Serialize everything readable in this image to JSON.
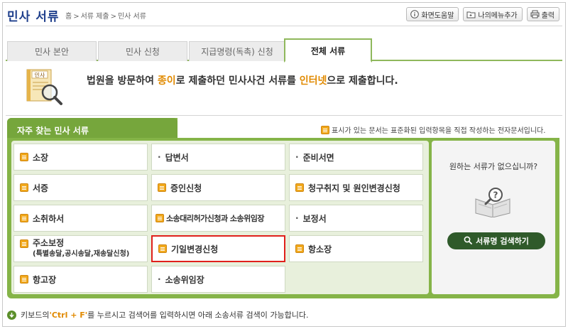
{
  "header": {
    "title": "민사 서류",
    "breadcrumb": [
      "홈",
      ">",
      "서류 제출",
      ">",
      "민사 서류"
    ],
    "buttons": {
      "help": "화면도움말",
      "add_menu": "나의메뉴추가",
      "print": "출력"
    }
  },
  "tabs": [
    {
      "label": "민사 본안",
      "active": false
    },
    {
      "label": "민사 신청",
      "active": false
    },
    {
      "label": "지급명령(독촉) 신청",
      "active": false
    },
    {
      "label": "전체 서류",
      "active": true
    }
  ],
  "intro": {
    "icon_label": "민사",
    "text_before": "법원을 방문하여 ",
    "highlight1": "종이",
    "text_mid": "로 제출하던 민사사건 서류를 ",
    "highlight2": "인터넷",
    "text_after": "으로 제출합니다."
  },
  "panel": {
    "title": "자주 찾는 민사 서류",
    "legend_note": "표시가 있는 문서는 표준화된 입력항목을 직접 작성하는 전자문서입니다.",
    "cells": [
      {
        "label": "소장",
        "type": "doc"
      },
      {
        "label": "답변서",
        "type": "dot"
      },
      {
        "label": "준비서면",
        "type": "dot"
      },
      {
        "label": "서증",
        "type": "doc"
      },
      {
        "label": "증인신청",
        "type": "doc"
      },
      {
        "label": "청구취지 및 원인변경신청",
        "type": "doc"
      },
      {
        "label": "소취하서",
        "type": "doc"
      },
      {
        "label": "소송대리허가신청과 소송위임장",
        "type": "doc"
      },
      {
        "label": "보정서",
        "type": "dot"
      },
      {
        "label": "주소보정",
        "sub": "(특별송달,공시송달,재송달신청)",
        "type": "doc"
      },
      {
        "label": "기일변경신청",
        "type": "doc",
        "highlight": true
      },
      {
        "label": "항소장",
        "type": "doc"
      },
      {
        "label": "항고장",
        "type": "doc"
      },
      {
        "label": "소송위임장",
        "type": "dot"
      }
    ],
    "side": {
      "question": "원하는 서류가 없으십니까?",
      "search_button": "서류명 검색하기"
    }
  },
  "footer": {
    "before": "키보드의 ",
    "key": "'Ctrl + F'",
    "after": "를 누르시고 검색어를 입력하시면 아래 소송서류 검색이 가능합니다."
  },
  "colors": {
    "panel_green": "#85b448",
    "accent_orange": "#e18a00",
    "title_blue": "#1f3f8c",
    "highlight_red": "#e0201b"
  }
}
